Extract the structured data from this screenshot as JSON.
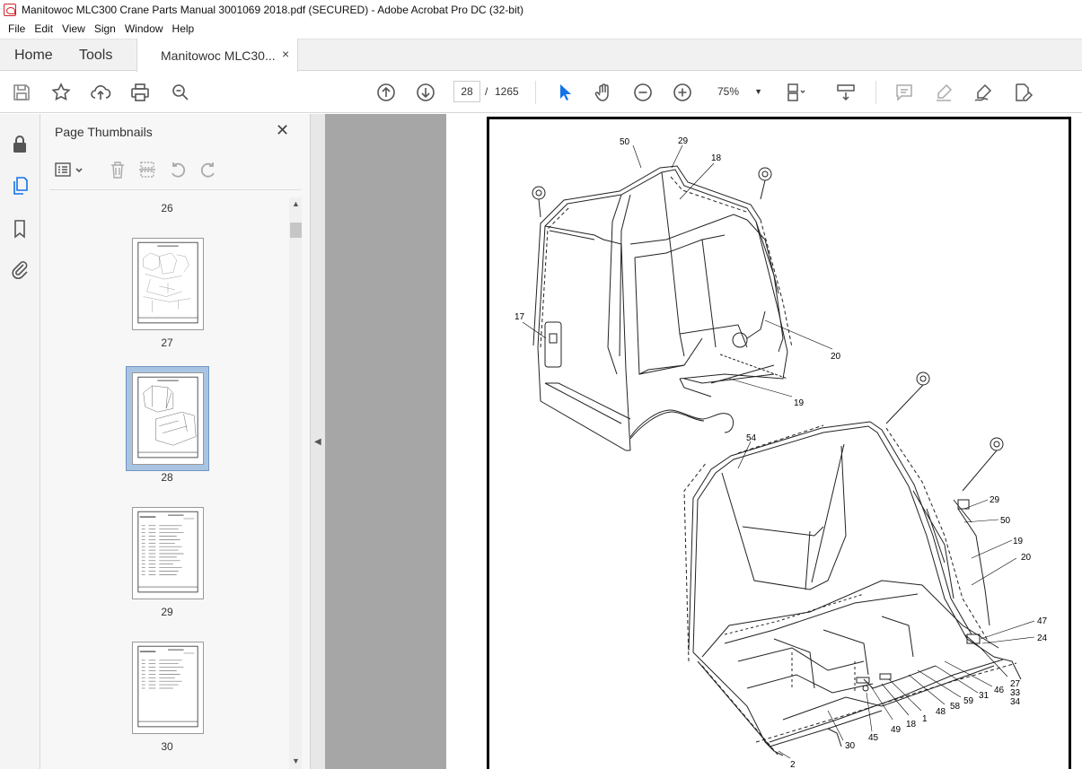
{
  "window": {
    "title": "Manitowoc MLC300 Crane Parts Manual 3001069 2018.pdf (SECURED) - Adobe Acrobat Pro DC (32-bit)"
  },
  "menu": [
    "File",
    "Edit",
    "View",
    "Sign",
    "Window",
    "Help"
  ],
  "tabs": {
    "home": "Home",
    "tools": "Tools",
    "document": "Manitowoc MLC30...",
    "close_glyph": "×"
  },
  "toolbar": {
    "current_page": "28",
    "page_separator": "/",
    "total_pages": "1265",
    "zoom": "75%",
    "icons": [
      "save-icon",
      "bookmark-star-icon",
      "upload-icon",
      "print-icon",
      "search-zoom-icon",
      "prev-page-icon",
      "next-page-icon",
      "select-arrow-icon",
      "hand-icon",
      "zoom-out-icon",
      "zoom-in-icon",
      "page-fit-icon",
      "scroll-mode-icon",
      "comment-icon",
      "highlight-icon",
      "sign-icon",
      "edit-pdf-icon"
    ]
  },
  "left_rail": {
    "icons": [
      "lock-icon",
      "page-thumbnails-icon",
      "bookmarks-icon",
      "attachment-icon"
    ]
  },
  "thumbnails_panel": {
    "title": "Page Thumbnails",
    "close_glyph": "✕",
    "pages": [
      {
        "number": "26",
        "selected": false
      },
      {
        "number": "27",
        "selected": false
      },
      {
        "number": "28",
        "selected": true
      },
      {
        "number": "29",
        "selected": false
      },
      {
        "number": "30",
        "selected": false
      }
    ]
  },
  "drawing": {
    "callouts": [
      "50",
      "29",
      "18",
      "17",
      "20",
      "19",
      "54",
      "29",
      "50",
      "19",
      "20",
      "47",
      "24",
      "27",
      "33",
      "34",
      "46",
      "31",
      "59",
      "58",
      "48",
      "1",
      "18",
      "49",
      "45",
      "30",
      "2"
    ]
  }
}
